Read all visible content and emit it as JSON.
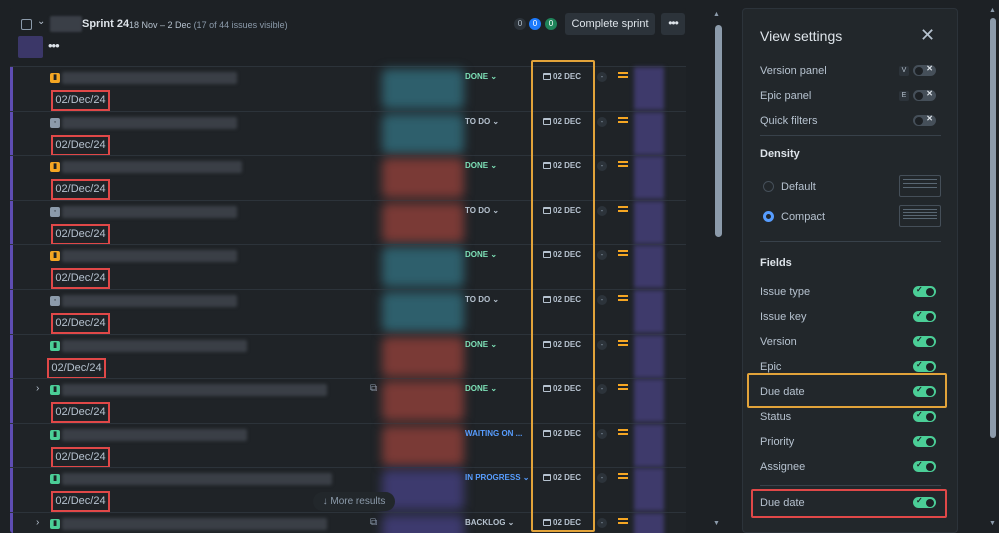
{
  "sprint": {
    "name": "Sprint 24",
    "dates": "18 Nov – 2 Dec",
    "visible": "(17 of 44 issues visible)",
    "count_todo": "0",
    "count_inprogress": "0",
    "count_done": "0",
    "complete_label": "Complete sprint",
    "more_label": "•••",
    "menu_label": "•••"
  },
  "rows": [
    {
      "status": "DONE ⌄",
      "due": "02 DEC",
      "dash": "-",
      "date": "02/Dec/24"
    },
    {
      "status": "TO DO ⌄",
      "due": "02 DEC",
      "dash": "-",
      "date": "02/Dec/24"
    },
    {
      "status": "DONE ⌄",
      "due": "02 DEC",
      "dash": "-",
      "date": "02/Dec/24"
    },
    {
      "status": "TO DO ⌄",
      "due": "02 DEC",
      "dash": "-",
      "date": "02/Dec/24"
    },
    {
      "status": "DONE ⌄",
      "due": "02 DEC",
      "dash": "-",
      "date": "02/Dec/24"
    },
    {
      "status": "TO DO ⌄",
      "due": "02 DEC",
      "dash": "-",
      "date": "02/Dec/24"
    },
    {
      "status": "DONE ⌄",
      "due": "02 DEC",
      "dash": "-",
      "date": "02/Dec/24"
    },
    {
      "status": "DONE ⌄",
      "due": "02 DEC",
      "dash": "-",
      "date": "02/Dec/24"
    },
    {
      "status": "WAITING ON ...",
      "due": "02 DEC",
      "dash": "-",
      "date": "02/Dec/24"
    },
    {
      "status": "IN PROGRESS ⌄",
      "due": "02 DEC",
      "dash": "-",
      "date": "02/Dec/24"
    },
    {
      "status": "BACKLOG ⌄",
      "due": "02 DEC",
      "dash": "-",
      "date": ""
    }
  ],
  "more_results": "More results",
  "view_settings": {
    "title": "View settings",
    "version_panel": "Version panel",
    "version_key": "V",
    "epic_panel": "Epic panel",
    "epic_key": "E",
    "quick_filters": "Quick filters",
    "density": "Density",
    "density_default": "Default",
    "density_compact": "Compact",
    "fields": "Fields",
    "issue_type": "Issue type",
    "issue_key": "Issue key",
    "version": "Version",
    "epic": "Epic",
    "due_date": "Due date",
    "status": "Status",
    "priority": "Priority",
    "assignee": "Assignee",
    "due_date_2": "Due date"
  },
  "colors": {
    "accent": "#579dff",
    "toggle_on": "#4bce97",
    "highlight_yellow": "#e2a33a",
    "highlight_red": "#e04848"
  }
}
